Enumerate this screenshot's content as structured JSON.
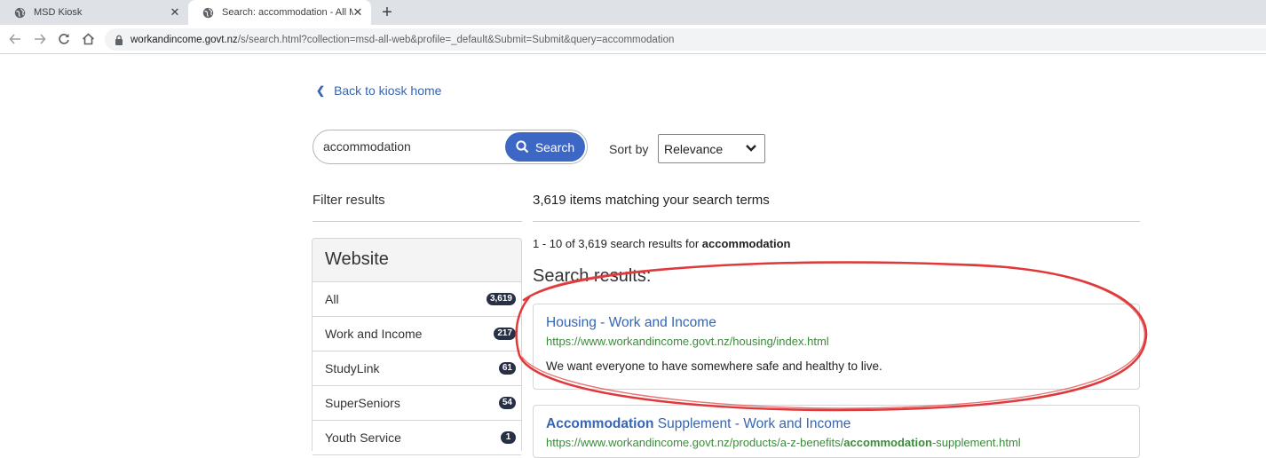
{
  "browser": {
    "tabs": [
      {
        "title": "MSD Kiosk",
        "close": "✕"
      },
      {
        "title": "Search: accommodation - All MSD",
        "close": "✕"
      }
    ],
    "new_tab": "+",
    "url_host": "workandincome.govt.nz",
    "url_path": "/s/search.html?collection=msd-all-web&profile=_default&Submit=Submit&query=accommodation"
  },
  "page": {
    "back_link": "Back to kiosk home",
    "search": {
      "value": "accommodation",
      "button": "Search"
    },
    "sort": {
      "label": "Sort by",
      "selected": "Relevance"
    },
    "filter_heading": "Filter results",
    "facet": {
      "title": "Website",
      "items": [
        {
          "label": "All",
          "count": "3,619"
        },
        {
          "label": "Work and Income",
          "count": "217"
        },
        {
          "label": "StudyLink",
          "count": "61"
        },
        {
          "label": "SuperSeniors",
          "count": "54"
        },
        {
          "label": "Youth Service",
          "count": "1"
        }
      ]
    },
    "match_heading": "3,619 items matching your search terms",
    "range": {
      "prefix": "1 - 10 of 3,619 search results for ",
      "query": "accommodation"
    },
    "results_heading": "Search results:",
    "results": [
      {
        "title": "Housing - Work and Income",
        "url": "https://www.workandincome.govt.nz/housing/index.html",
        "desc": "We want everyone to have somewhere safe and healthy to live."
      },
      {
        "title_bold": "Accommodation",
        "title_rest": " Supplement - Work and Income",
        "url_prefix": "https://www.workandincome.govt.nz/products/a-z-benefits/",
        "url_bold": "accommodation",
        "url_suffix": "-supplement.html"
      }
    ]
  },
  "colors": {
    "link": "#3566b4",
    "url_green": "#3d8a3d",
    "search_button": "#3d67c4",
    "badge": "#283046",
    "annotation": "#e0393b"
  }
}
